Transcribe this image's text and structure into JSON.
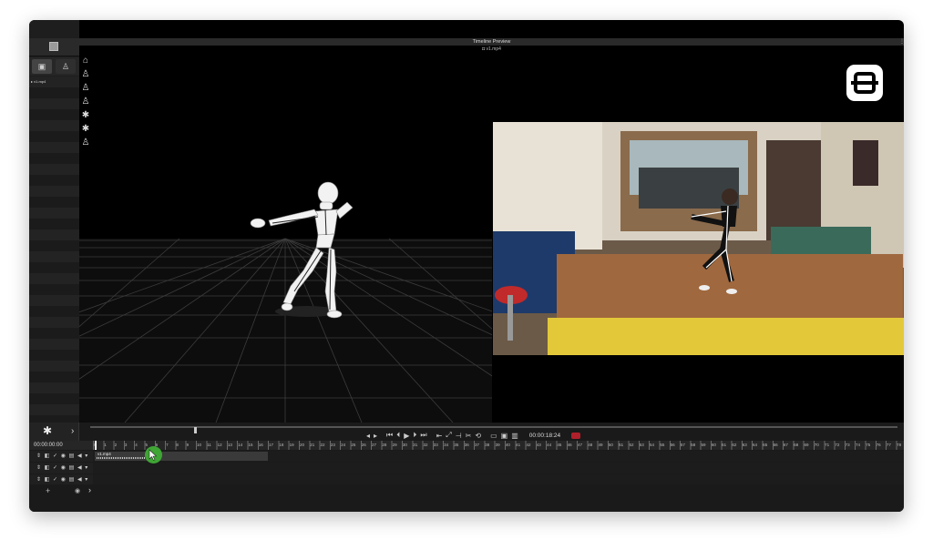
{
  "viewer": {
    "title": "Timeline Preview",
    "file_label": "v1.mp4"
  },
  "left_panel": {
    "file_item": "v1.mp4"
  },
  "timeline": {
    "timecode_current": "00:00:18:24",
    "timecode_start": "00:00:00:00",
    "clip_label": "v1.mp4",
    "ruler_ticks": [
      "0",
      "1",
      "2",
      "3",
      "4",
      "5",
      "6",
      "7",
      "8",
      "9",
      "10",
      "11",
      "12",
      "13",
      "14",
      "15",
      "16",
      "17",
      "18",
      "19",
      "20",
      "21",
      "22",
      "23",
      "24",
      "25",
      "26",
      "27",
      "28",
      "29",
      "30",
      "31",
      "32",
      "33",
      "34",
      "35",
      "36",
      "37",
      "38",
      "39",
      "40",
      "41",
      "42",
      "43",
      "44",
      "45",
      "46",
      "47",
      "48",
      "49",
      "50",
      "51",
      "52",
      "53",
      "54",
      "55",
      "56",
      "57",
      "58",
      "59",
      "60",
      "61",
      "62",
      "63",
      "64",
      "65",
      "66",
      "67",
      "68",
      "69",
      "70",
      "71",
      "72",
      "73",
      "74",
      "75",
      "76",
      "77",
      "78"
    ],
    "tracks": [
      {
        "controls": "⇕ ◧ ✓ ◉ ▤ ◀ ▾"
      },
      {
        "controls": "⇕ ◧ ✓ ◉ ▤ ◀ ▾"
      },
      {
        "controls": "⇕ ◧ ✓ ◉ ▤ ◀ ▾"
      }
    ]
  },
  "colors": {
    "accent_record": "#b0202a",
    "cursor": "#3fa535"
  }
}
